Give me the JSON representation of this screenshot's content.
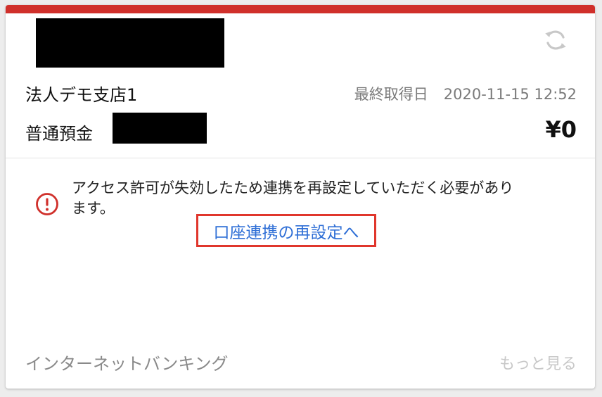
{
  "account_card": {
    "bank_name": "法人デモ支店1",
    "last_fetched_label": "最終取得日",
    "last_fetched_value": "2020-11-15 12:52",
    "account_type": "普通預金",
    "balance": "¥0"
  },
  "alert": {
    "message": "アクセス許可が失効したため連携を再設定していただく必要があります。",
    "reconnect_link": "口座連携の再設定へ"
  },
  "footer": {
    "category": "インターネットバンキング",
    "see_more": "もっと見る"
  },
  "icons": {
    "refresh": "refresh-icon",
    "alert": "alert-circle-icon"
  },
  "colors": {
    "top_bar": "#d0302b",
    "link": "#2f6fd6",
    "highlight_box": "#e0362c",
    "alert_icon": "#d0302b"
  }
}
